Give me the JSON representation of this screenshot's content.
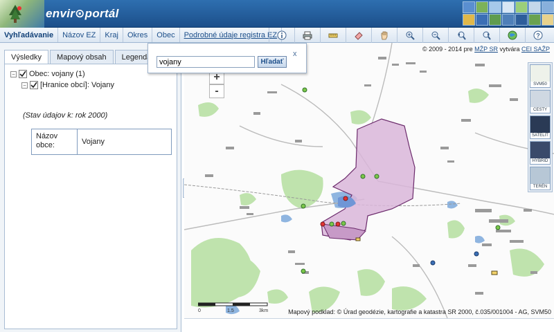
{
  "header": {
    "logo_text": "envir⊙portál"
  },
  "menu": {
    "items": [
      {
        "label": "Vyhľadávanie"
      },
      {
        "label": "Názov EZ"
      },
      {
        "label": "Kraj"
      },
      {
        "label": "Okres"
      },
      {
        "label": "Obec"
      },
      {
        "label": "Podrobné údaje registra EZ"
      }
    ],
    "tools": [
      "info-icon",
      "print-icon",
      "measure-icon",
      "eraser-icon",
      "pan-hand-icon",
      "zoom-in-icon",
      "zoom-out-icon",
      "zoom-previous-icon",
      "zoom-next-icon",
      "full-extent-globe-icon",
      "help-icon"
    ]
  },
  "left_panel": {
    "tabs": [
      {
        "label": "Výsledky",
        "active": true
      },
      {
        "label": "Mapový obsah"
      },
      {
        "label": "Legenda"
      }
    ],
    "tree": {
      "root_label": "Obec: vojany (1)",
      "child_label": "[Hranice obcí]: Vojany",
      "status": "(Stav údajov k: rok 2000)"
    },
    "info_table": {
      "key": "Názov obce:",
      "value": "Vojany"
    }
  },
  "search": {
    "value": "vojany",
    "button_label": "Hľadať",
    "close_label": "x"
  },
  "map": {
    "copyright_prefix": "© 2009 - 2014 pre ",
    "copyright_link1": "MŽP SR",
    "copyright_mid": " vytvára ",
    "copyright_link2": "CEI SAŽP",
    "zoom_in": "+",
    "zoom_out": "-",
    "layers": [
      {
        "label": "SVM50"
      },
      {
        "label": "CESTY"
      },
      {
        "label": "SATELIT"
      },
      {
        "label": "HYBRID"
      },
      {
        "label": "TERÉN"
      }
    ],
    "scale_labels": [
      "0",
      "1.5",
      "3km"
    ],
    "attribution": "Mapový podklad: © Úrad geodézie, kartografie a katastra SR 2000, č.035/001004 - AG, SVM50",
    "colors": {
      "highlight_fill": "#d9b6d9",
      "highlight_stroke": "#6b2a6b",
      "water": "#8fb5e0",
      "forest": "#bfe3ad"
    }
  }
}
